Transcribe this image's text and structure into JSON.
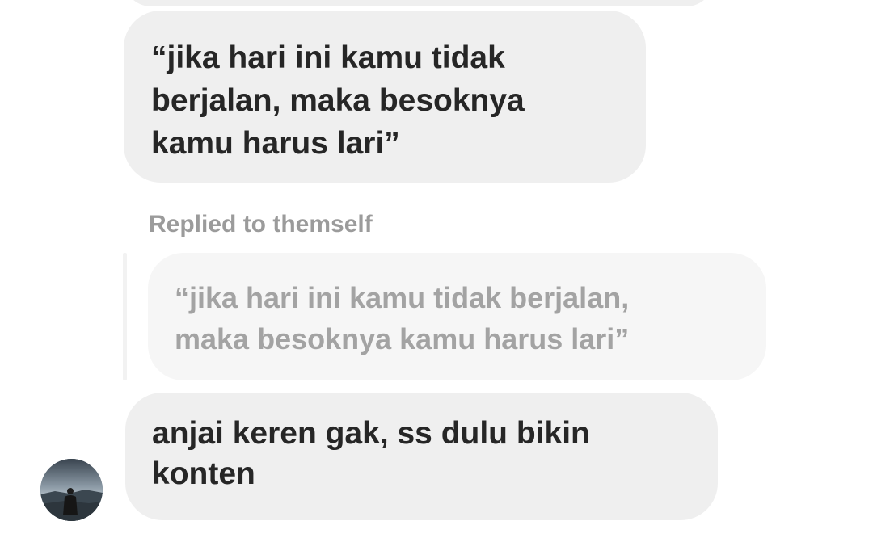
{
  "conversation": {
    "messages": [
      {
        "text": "“jika hari ini kamu tidak\nberjalan, maka besoknya\nkamu harus lari”"
      },
      {
        "reply_label": "Replied to themself",
        "quoted_text": "“jika hari ini kamu tidak berjalan,\nmaka besoknya kamu harus lari”",
        "text": "anjai keren gak, ss dulu bikin\nkonten"
      }
    ]
  },
  "colors": {
    "bubble": "#efefef",
    "quoted_bubble": "#f6f6f6",
    "text": "#262626",
    "muted_text": "#9b9b9b"
  },
  "icons": {
    "avatar": "user-avatar"
  }
}
